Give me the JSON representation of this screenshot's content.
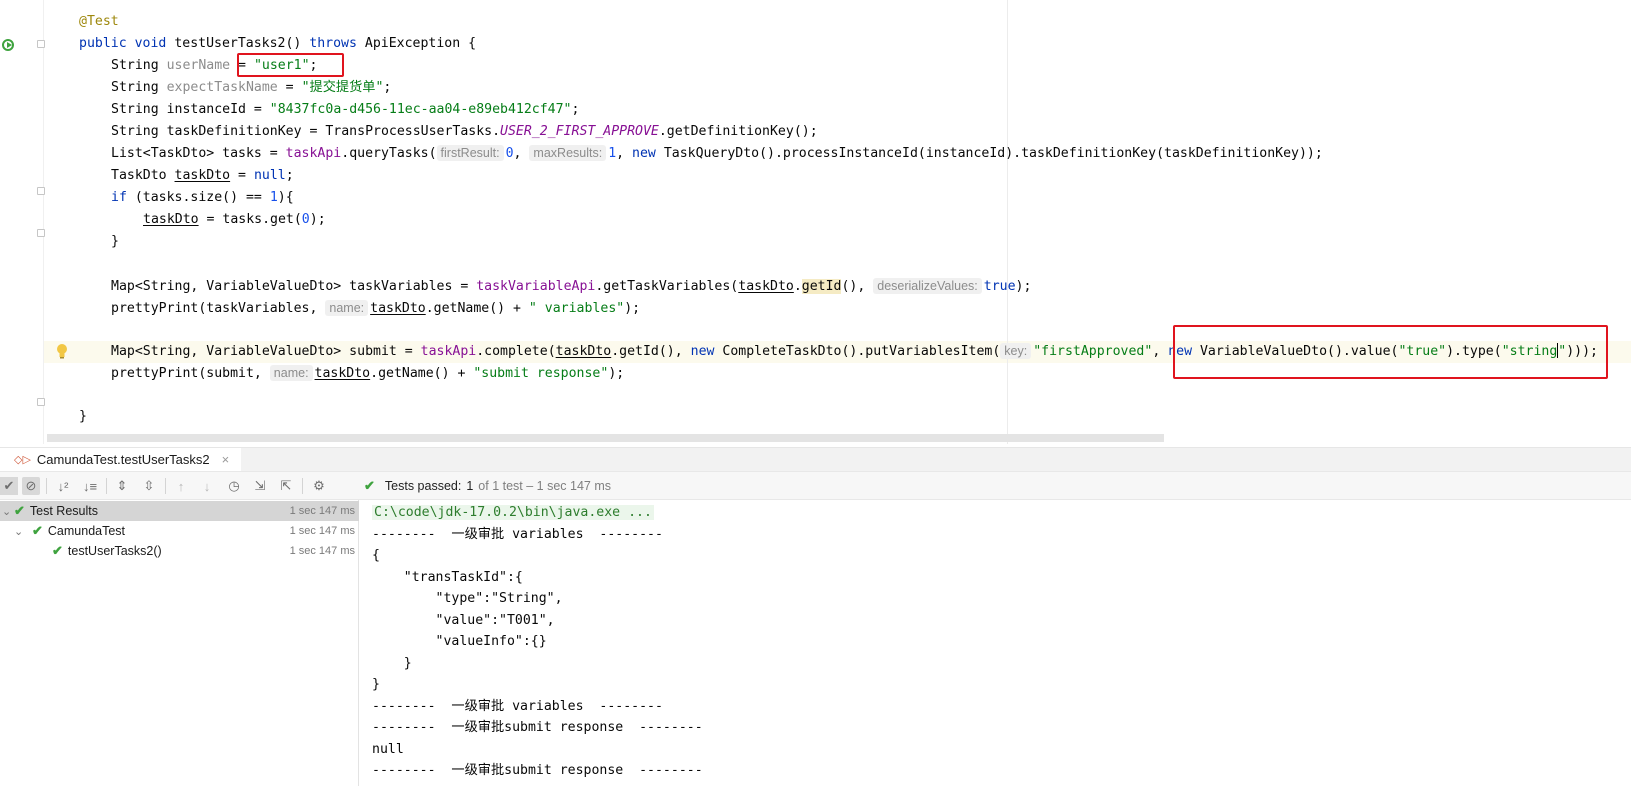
{
  "code": {
    "annotation": "@Test",
    "kw_public": "public",
    "kw_void": "void",
    "method_name": "testUserTasks2",
    "throws": "throws",
    "exception": "ApiException",
    "l3": {
      "type": "String ",
      "var": "userName",
      "eq": " = ",
      "val": "\"user1\"",
      "end": ";"
    },
    "l4": {
      "type": "String ",
      "var": "expectTaskName",
      "eq": " = ",
      "val": "\"提交提货单\"",
      "end": ";"
    },
    "l5": {
      "type": "String instanceId = ",
      "val": "\"8437fc0a-d456-11ec-aa04-e89eb412cf47\"",
      "end": ";"
    },
    "l6": {
      "a": "String taskDefinitionKey = TransProcessUserTasks.",
      "const": "USER_2_FIRST_APPROVE",
      "b": ".getDefinitionKey();"
    },
    "l7": {
      "a": "List<TaskDto> tasks = ",
      "api": "taskApi",
      "b": ".queryTasks(",
      "h1": "firstResult:",
      "n1": "0",
      "c": ", ",
      "h2": "maxResults:",
      "n2": "1",
      "d": ", ",
      "new": "new",
      "e": " TaskQueryDto().processInstanceId(instanceId).taskDefinitionKey(taskDefinitionKey));"
    },
    "l8": {
      "a": "TaskDto ",
      "var": "taskDto",
      "b": " = ",
      "null": "null",
      "end": ";"
    },
    "l9": {
      "if": "if",
      "a": " (tasks.size() == ",
      "n": "1",
      "b": "){"
    },
    "l10": {
      "var": "taskDto",
      "a": " = tasks.get(",
      "n": "0",
      "b": ");"
    },
    "l11": "}",
    "l12": {
      "a": "Map<String, VariableValueDto> taskVariables = ",
      "api": "taskVariableApi",
      "b": ".getTaskVariables(",
      "var": "taskDto",
      "dot": ".",
      "id": "getId",
      "c": "(), ",
      "h": "deserializeValues:",
      "t": "true",
      "d": ");"
    },
    "l13": {
      "a": "prettyPrint(taskVariables, ",
      "h": "name:",
      "var": "taskDto",
      "b": ".getName() + ",
      "s": "\" variables\"",
      "c": ");"
    },
    "l14": {
      "a": "Map<String, VariableValueDto> submit = ",
      "api": "taskApi",
      "b": ".complete(",
      "var": "taskDto",
      "c": ".getId(), ",
      "new1": "new",
      "d": " CompleteTaskDto().putVariablesItem(",
      "h": "key:",
      "s1": "\"firstApproved\"",
      "e": ", ",
      "new2": "new",
      "f": " VariableValueDto().value(",
      "s2": "\"true\"",
      "g": ").type(",
      "s3a": "\"string",
      "s3b": "\"",
      "end": ")));"
    },
    "l15": {
      "a": "prettyPrint(submit, ",
      "h": "name:",
      "var": "taskDto",
      "b": ".getName() + ",
      "s": "\"submit response\"",
      "c": ");"
    },
    "l16": "}"
  },
  "run": {
    "tab_title": "CamundaTest.testUserTasks2",
    "status_passed": "Tests passed:",
    "status_count": "1",
    "status_rest": "of 1 test – 1 sec 147 ms",
    "tree": [
      {
        "label": "Test Results",
        "time": "1 sec 147 ms"
      },
      {
        "label": "CamundaTest",
        "time": "1 sec 147 ms"
      },
      {
        "label": "testUserTasks2()",
        "time": "1 sec 147 ms"
      }
    ],
    "console": [
      "C:\\code\\jdk-17.0.2\\bin\\java.exe ...",
      "--------  一级审批 variables  --------",
      "{",
      "    \"transTaskId\":{",
      "        \"type\":\"String\",",
      "        \"value\":\"T001\",",
      "        \"valueInfo\":{}",
      "    }",
      "}",
      "--------  一级审批 variables  --------",
      "--------  一级审批submit response  --------",
      "null",
      "--------  一级审批submit response  --------"
    ]
  },
  "colors": {
    "keyword": "#0033b3",
    "string": "#067d17",
    "annotation": "#9e880d",
    "highlight_box": "#e0141e",
    "pass_green": "#3fa33f"
  }
}
